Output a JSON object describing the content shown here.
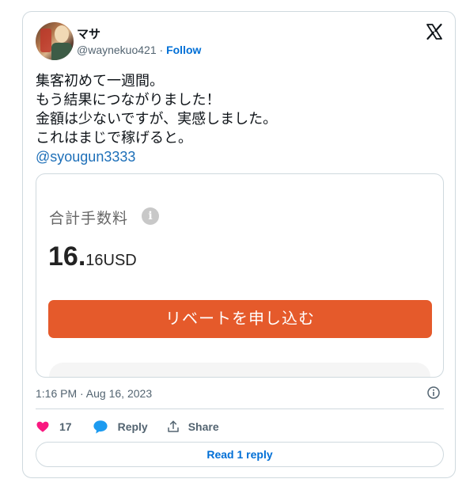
{
  "author": {
    "name": "マサ",
    "handle": "@waynekuo421",
    "separator": "·",
    "follow_label": "Follow"
  },
  "tweet": {
    "text": "集客初めて一週間。\nもう結果につながりました！\n金額は少ないですが、実感しました。\nこれはまじで稼げると。",
    "mention": "@syougun3333"
  },
  "media": {
    "fee_label": "合計手数料",
    "info_icon_glyph": "i",
    "amount_integer": "16.",
    "amount_decimal": "16USD",
    "rebate_button": "リベートを申し込む",
    "button_color": "#e55a2b"
  },
  "meta": {
    "timestamp": "1:16 PM · Aug 16, 2023"
  },
  "actions": {
    "like_count": "17",
    "reply_label": "Reply",
    "share_label": "Share",
    "like_color": "#f91880",
    "reply_color": "#1d9bf0"
  },
  "read_replies_label": "Read 1 reply"
}
